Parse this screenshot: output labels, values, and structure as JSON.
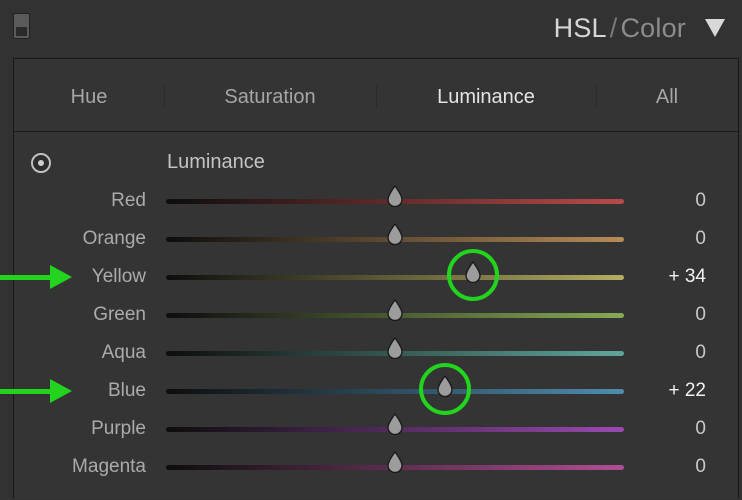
{
  "header": {
    "title_active": "HSL",
    "title_separator": "/",
    "title_inactive": "Color",
    "collapse_icon": "triangle-down-icon",
    "panel_switch_icon": "panel-switch-icon"
  },
  "tabs": [
    {
      "label": "Hue",
      "active": false
    },
    {
      "label": "Saturation",
      "active": false
    },
    {
      "label": "Luminance",
      "active": true
    },
    {
      "label": "All",
      "active": false
    }
  ],
  "section": {
    "label": "Luminance",
    "target_icon": "target-adjustment-icon"
  },
  "sliders": [
    {
      "label": "Red",
      "value_text": "0",
      "value": 0,
      "track_color": "#b94a4a"
    },
    {
      "label": "Orange",
      "value_text": "0",
      "value": 0,
      "track_color": "#b68c58"
    },
    {
      "label": "Yellow",
      "value_text": "+ 34",
      "value": 34,
      "track_color": "#b4ad62"
    },
    {
      "label": "Green",
      "value_text": "0",
      "value": 0,
      "track_color": "#86ab55"
    },
    {
      "label": "Aqua",
      "value_text": "0",
      "value": 0,
      "track_color": "#5ea79b"
    },
    {
      "label": "Blue",
      "value_text": "+ 22",
      "value": 22,
      "track_color": "#4f8db0"
    },
    {
      "label": "Purple",
      "value_text": "0",
      "value": 0,
      "track_color": "#9a4ab0"
    },
    {
      "label": "Magenta",
      "value_text": "0",
      "value": 0,
      "track_color": "#b04e93"
    }
  ],
  "slider_range": [
    -100,
    100
  ],
  "annotations": {
    "color": "#22d41e",
    "highlighted": [
      "Yellow",
      "Blue"
    ]
  },
  "colors": {
    "background": "#323232",
    "panel": "#343434",
    "text": "#ababab",
    "active_text": "#e4e4e4"
  }
}
